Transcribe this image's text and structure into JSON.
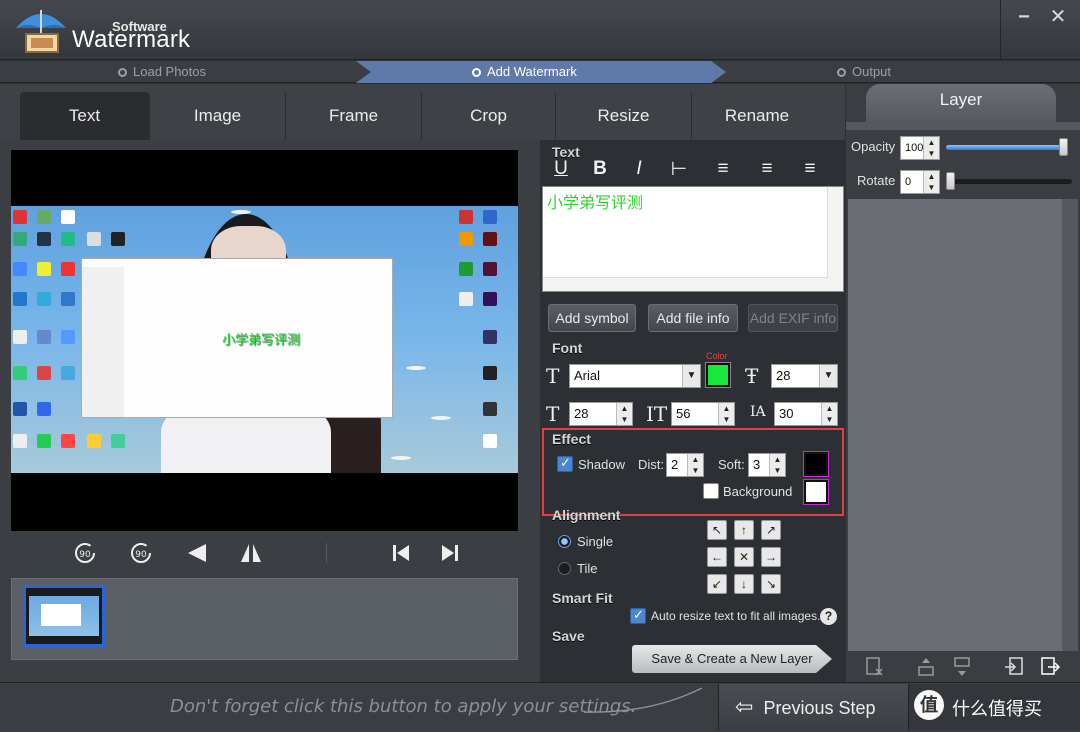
{
  "app": {
    "subtitle": "Software",
    "title": "Watermark",
    "minimize_glyph": "−",
    "close_glyph": "✕",
    "logo_icon": "umbrella-photo-icon"
  },
  "steps": [
    {
      "label": "Load Photos",
      "active": false
    },
    {
      "label": "Add Watermark",
      "active": true
    },
    {
      "label": "Output",
      "active": false
    }
  ],
  "tabs": [
    {
      "label": "Text",
      "active": true
    },
    {
      "label": "Image",
      "active": false
    },
    {
      "label": "Frame",
      "active": false
    },
    {
      "label": "Crop",
      "active": false
    },
    {
      "label": "Resize",
      "active": false
    },
    {
      "label": "Rename",
      "active": false
    }
  ],
  "preview": {
    "watermark_text": "小学弟写评测",
    "controls": [
      "rotate-left-90-icon",
      "rotate-right-90-icon",
      "flip-horizontal-icon",
      "flip-vertical-icon",
      "previous-image-icon",
      "next-image-icon"
    ],
    "rotate_label": "90"
  },
  "text_section": {
    "label": "Text",
    "format_buttons": [
      "U",
      "B",
      "I",
      "⊢",
      "≡",
      "≡",
      "≡"
    ],
    "content": "小学弟写评测",
    "add_symbol": "Add symbol",
    "add_file_info": "Add file info",
    "add_exif_info": "Add EXIF info"
  },
  "font_section": {
    "label": "Font",
    "font_name": "Arial",
    "color_label": "Color",
    "color": "#19e83a",
    "size": "28",
    "width": "28",
    "line_height": "56",
    "spacing": "30"
  },
  "effect_section": {
    "label": "Effect",
    "shadow_label": "Shadow",
    "shadow_checked": true,
    "dist_label": "Dist:",
    "dist": "2",
    "soft_label": "Soft:",
    "soft": "3",
    "shadow_color": "#000000",
    "background_label": "Background",
    "background_checked": false,
    "background_color": "#ffffff"
  },
  "alignment_section": {
    "label": "Alignment",
    "single_label": "Single",
    "tile_label": "Tile",
    "mode": "Single",
    "arrows": [
      "↖",
      "↑",
      "↗",
      "←",
      "✕",
      "→",
      "↙",
      "↓",
      "↘"
    ]
  },
  "smartfit_section": {
    "label": "Smart Fit",
    "auto_resize_label": "Auto resize text to fit all images.",
    "checked": true,
    "help_glyph": "?"
  },
  "save_section": {
    "label": "Save",
    "button": "Save & Create a New Layer"
  },
  "layer_panel": {
    "title": "Layer",
    "opacity_label": "Opacity",
    "opacity": "100",
    "opacity_level": 1.0,
    "rotate_label": "Rotate",
    "rotate": "0",
    "rotate_level": 0.0,
    "tools": [
      "delete-layer-icon",
      "move-layer-up-icon",
      "move-layer-down-icon",
      "import-layer-icon",
      "export-layer-icon"
    ]
  },
  "bottom": {
    "hint": "Don't forget click this button to apply your settings.",
    "previous_step": "Previous Step",
    "brand_glyph": "值",
    "brand_text": "什么值得买"
  }
}
